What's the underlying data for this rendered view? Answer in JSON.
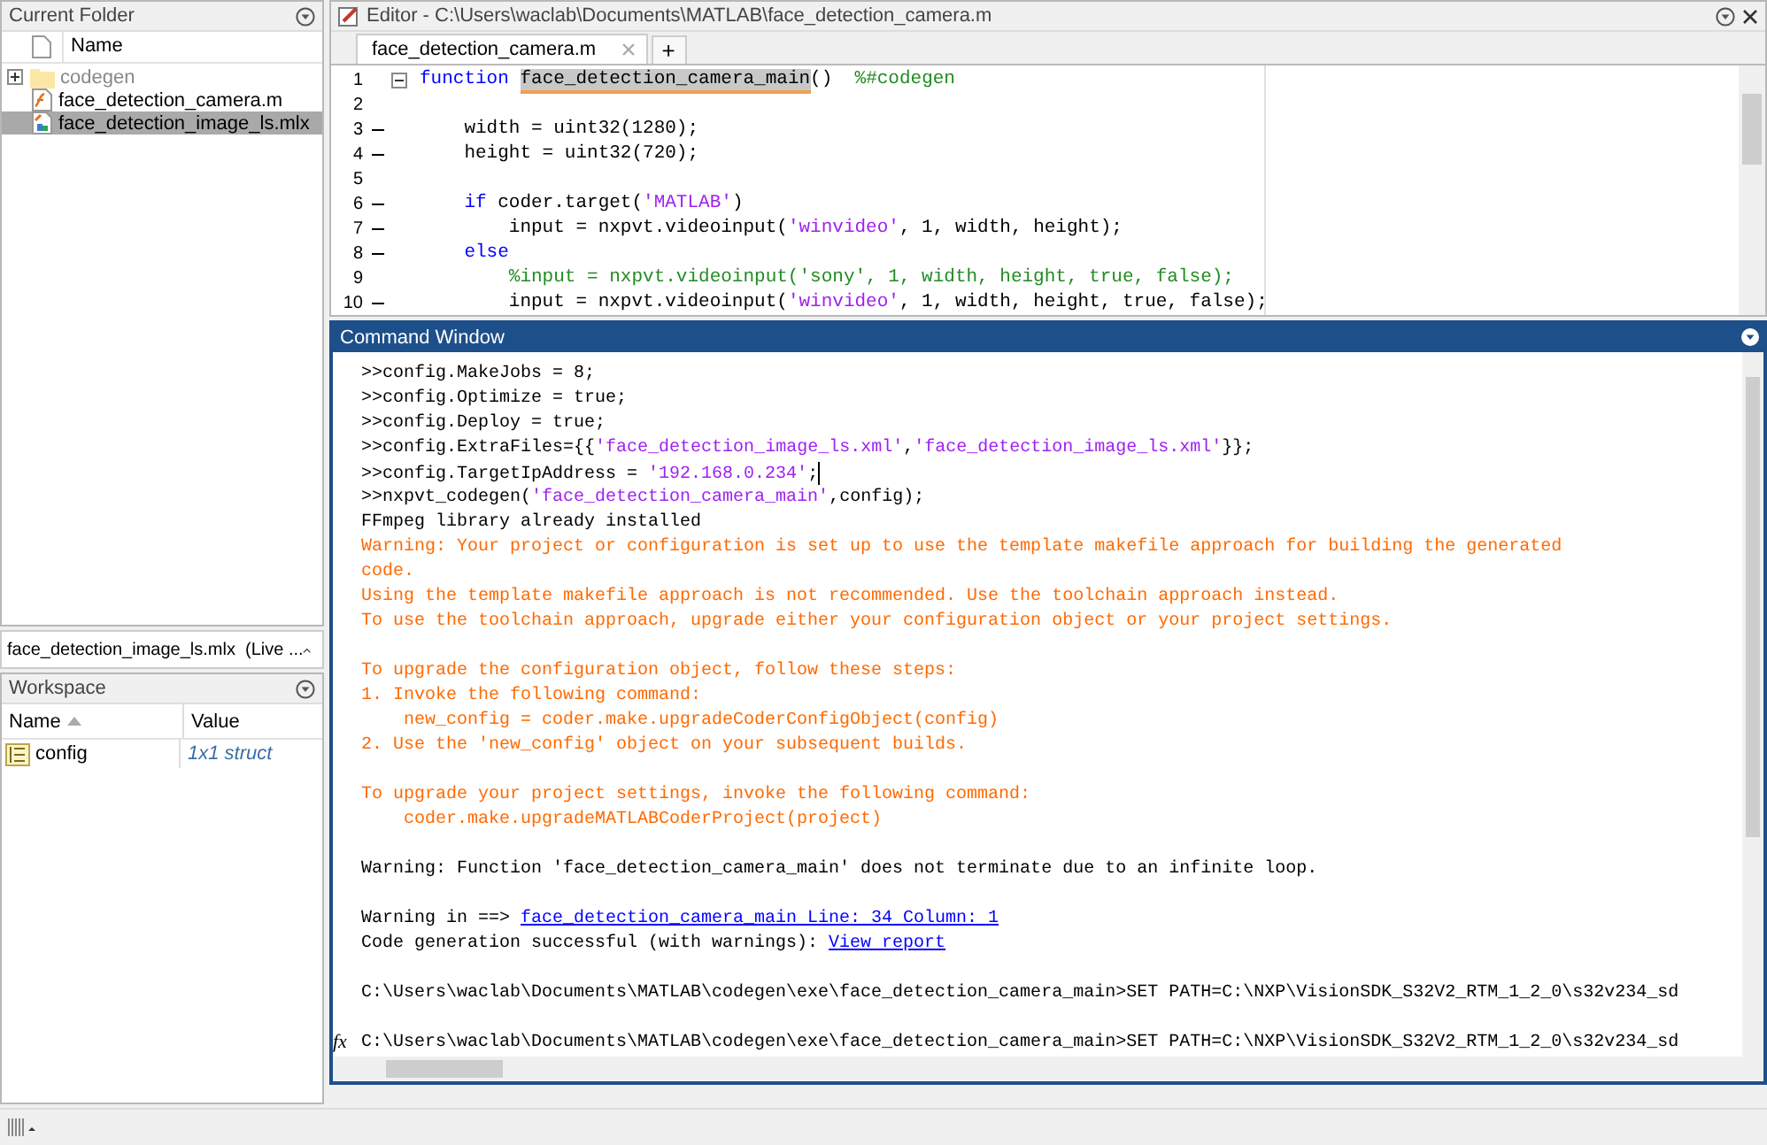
{
  "current_folder": {
    "title": "Current Folder",
    "column": "Name",
    "items": [
      {
        "kind": "folder",
        "name": "codegen",
        "dimmed": true,
        "selected": false,
        "expanded": false
      },
      {
        "kind": "m",
        "name": "face_detection_camera.m",
        "dimmed": false,
        "selected": false
      },
      {
        "kind": "mlx",
        "name": "face_detection_image_ls.mlx",
        "dimmed": false,
        "selected": true
      }
    ],
    "details": "face_detection_image_ls.mlx  (Live ..."
  },
  "workspace": {
    "title": "Workspace",
    "columns": [
      {
        "label": "Name",
        "sorted": true
      },
      {
        "label": "Value",
        "sorted": false
      }
    ],
    "rows": [
      {
        "name": "config",
        "value": "1x1 struct"
      }
    ]
  },
  "editor": {
    "title": "Editor - C:\\Users\\waclab\\Documents\\MATLAB\\face_detection_camera.m",
    "tabs": [
      {
        "label": "face_detection_camera.m",
        "selected": true
      }
    ],
    "add_tab": "+",
    "lines": [
      {
        "number": "1",
        "executable": false,
        "foldable": true,
        "segments": [
          {
            "kind": "keyword",
            "text": "function "
          },
          {
            "kind": "highlight",
            "text": "face_detection_camera_main"
          },
          {
            "kind": "plain",
            "text": "()  "
          },
          {
            "kind": "comment",
            "text": "%#codegen"
          }
        ]
      },
      {
        "number": "2",
        "executable": false,
        "foldable": false
      },
      {
        "number": "3",
        "executable": true,
        "foldable": false,
        "segments": [
          {
            "kind": "plain",
            "text": "    width = uint32(1280);"
          }
        ]
      },
      {
        "number": "4",
        "executable": true,
        "foldable": false,
        "segments": [
          {
            "kind": "plain",
            "text": "    height = uint32(720);"
          }
        ]
      },
      {
        "number": "5",
        "executable": false,
        "foldable": false
      },
      {
        "number": "6",
        "executable": true,
        "foldable": false,
        "segments": [
          {
            "kind": "keyword",
            "text": "    if "
          },
          {
            "kind": "plain",
            "text": "coder.target("
          },
          {
            "kind": "string",
            "text": "'MATLAB'"
          },
          {
            "kind": "plain",
            "text": ")"
          }
        ]
      },
      {
        "number": "7",
        "executable": true,
        "foldable": false,
        "segments": [
          {
            "kind": "plain",
            "text": "        input = nxpvt.videoinput("
          },
          {
            "kind": "string",
            "text": "'winvideo'"
          },
          {
            "kind": "plain",
            "text": ", 1, width, height);"
          }
        ]
      },
      {
        "number": "8",
        "executable": true,
        "foldable": false,
        "segments": [
          {
            "kind": "keyword",
            "text": "    else"
          }
        ]
      },
      {
        "number": "9",
        "executable": false,
        "foldable": false,
        "segments": [
          {
            "kind": "comment",
            "text": "        %input = nxpvt.videoinput('sony', 1, width, height, true, false);"
          }
        ]
      },
      {
        "number": "10",
        "executable": true,
        "foldable": false,
        "segments": [
          {
            "kind": "plain",
            "text": "        input = nxpvt.videoinput("
          },
          {
            "kind": "string",
            "text": "'winvideo'"
          },
          {
            "kind": "plain",
            "text": ", 1, width, height, true, false);"
          }
        ]
      }
    ]
  },
  "command_window": {
    "title": "Command Window",
    "prompt_icon": "fx",
    "blocks": [
      {
        "lines": [
          {
            "prompt": ">>",
            "segments": [
              {
                "kind": "plain",
                "text": "config.MakeJobs = 8;"
              }
            ]
          },
          {
            "prompt": ">>",
            "segments": [
              {
                "kind": "plain",
                "text": "config.Optimize = true;"
              }
            ]
          },
          {
            "prompt": ">>",
            "segments": [
              {
                "kind": "plain",
                "text": "config.Deploy = true;"
              }
            ]
          },
          {
            "prompt": ">>",
            "segments": [
              {
                "kind": "plain",
                "text": "config.ExtraFiles={{"
              },
              {
                "kind": "string",
                "text": "'face_detection_image_ls.xml'"
              },
              {
                "kind": "plain",
                "text": ","
              },
              {
                "kind": "string",
                "text": "'face_detection_image_ls.xml'"
              },
              {
                "kind": "plain",
                "text": "}};"
              }
            ]
          },
          {
            "prompt": ">>",
            "segments": [
              {
                "kind": "plain",
                "text": "config.TargetIpAddress = "
              },
              {
                "kind": "string",
                "text": "'192.168.0.234'"
              },
              {
                "kind": "plain",
                "text": ";"
              }
            ],
            "cursor": true
          },
          {
            "prompt": ">>",
            "segments": [
              {
                "kind": "plain",
                "text": "nxpvt_codegen("
              },
              {
                "kind": "string",
                "text": "'face_detection_camera_main'"
              },
              {
                "kind": "plain",
                "text": ",config);"
              }
            ]
          },
          {
            "segments": [
              {
                "kind": "plain",
                "text": "FFmpeg library already installed"
              }
            ]
          },
          {
            "segments": [
              {
                "kind": "warning",
                "text": "Warning: Your project or configuration is set up to use the template makefile approach for building the generated"
              }
            ]
          },
          {
            "segments": [
              {
                "kind": "warning",
                "text": "code."
              }
            ]
          },
          {
            "segments": [
              {
                "kind": "warning",
                "text": "Using the template makefile approach is not recommended. Use the toolchain approach instead."
              }
            ]
          },
          {
            "segments": [
              {
                "kind": "warning",
                "text": "To use the toolchain approach, upgrade either your configuration object or your project settings."
              }
            ]
          }
        ]
      },
      {
        "lines": [
          {
            "segments": [
              {
                "kind": "warning",
                "text": "To upgrade the configuration object, follow these steps:"
              }
            ]
          },
          {
            "segments": [
              {
                "kind": "warning",
                "text": "1. Invoke the following command:"
              }
            ]
          },
          {
            "segments": [
              {
                "kind": "warning",
                "text": "    new_config = coder.make.upgradeCoderConfigObject(config)"
              }
            ]
          },
          {
            "segments": [
              {
                "kind": "warning",
                "text": "2. Use the 'new_config' object on your subsequent builds."
              }
            ]
          }
        ]
      },
      {
        "lines": [
          {
            "segments": [
              {
                "kind": "warning",
                "text": "To upgrade your project settings, invoke the following command:"
              }
            ]
          },
          {
            "segments": [
              {
                "kind": "warning",
                "text": "    coder.make.upgradeMATLABCoderProject(project)"
              }
            ]
          }
        ]
      },
      {
        "lines": [
          {
            "segments": [
              {
                "kind": "plain",
                "text": "Warning: Function 'face_detection_camera_main' does not terminate due to an infinite loop."
              }
            ]
          }
        ]
      },
      {
        "lines": [
          {
            "segments": [
              {
                "kind": "plain",
                "text": "Warning in ==> "
              },
              {
                "kind": "link",
                "text": "face_detection_camera_main Line: 34 Column: 1"
              }
            ]
          },
          {
            "segments": [
              {
                "kind": "plain",
                "text": "Code generation successful (with warnings): "
              },
              {
                "kind": "link",
                "text": "View report"
              }
            ]
          }
        ]
      },
      {
        "lines": [
          {
            "segments": [
              {
                "kind": "plain",
                "text": "C:\\Users\\waclab\\Documents\\MATLAB\\codegen\\exe\\face_detection_camera_main>SET PATH=C:\\NXP\\VisionSDK_S32V2_RTM_1_2_0\\s32v234_sd"
              }
            ]
          }
        ]
      },
      {
        "lines": [
          {
            "segments": [
              {
                "kind": "plain",
                "text": "C:\\Users\\waclab\\Documents\\MATLAB\\codegen\\exe\\face_detection_camera_main>SET PATH=C:\\NXP\\VisionSDK_S32V2_RTM_1_2_0\\s32v234_sd"
              }
            ]
          }
        ]
      }
    ]
  }
}
